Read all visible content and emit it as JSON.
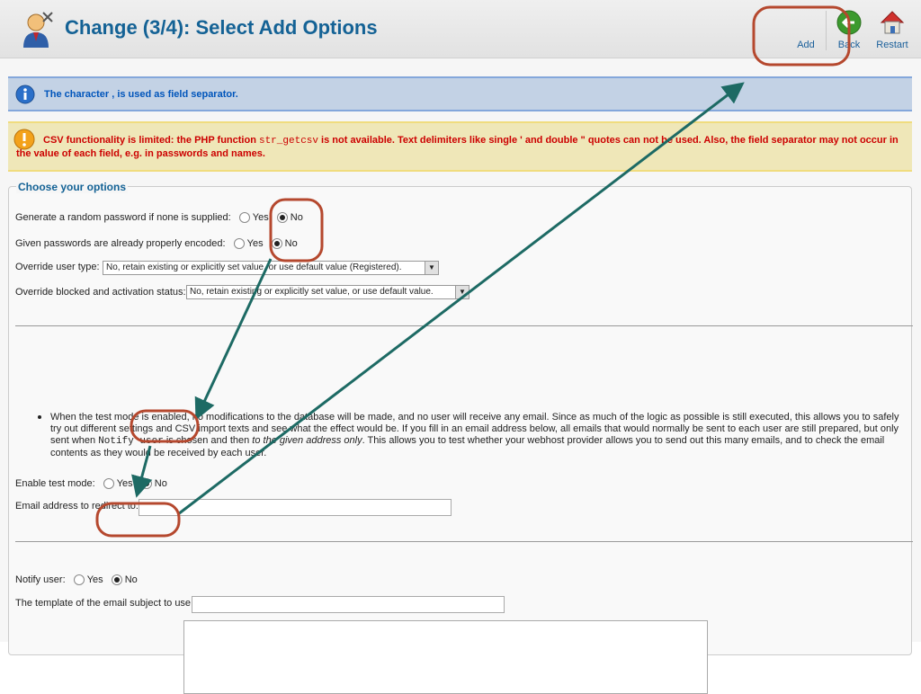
{
  "header": {
    "title": "Change (3/4): Select Add Options",
    "toolbar": {
      "add_label": "Add",
      "back_label": "Back",
      "restart_label": "Restart"
    }
  },
  "messages": {
    "info": "The character , is used as field separator.",
    "warning_pre": "CSV functionality is limited: the PHP function ",
    "warning_code": "str_getcsv",
    "warning_post": " is not available. Text delimiters like single ' and double \" quotes can not be used. Also, the field separator may not occur in the value of each field, e.g. in passwords and names."
  },
  "options": {
    "legend": "Choose your options",
    "random_password_label": "Generate a random password if none is supplied:",
    "encoded_label": "Given passwords are already properly encoded:",
    "yes_label": "Yes",
    "no_label": "No",
    "override_type_label": "Override user type:",
    "override_type_value": "No, retain existing or explicitly set value, or use default value (Registered).",
    "override_blocked_label": "Override blocked and activation status:",
    "override_blocked_value": "No, retain existing or explicitly set value, or use default value.",
    "test_mode_text_1": "When the test mode is enabled, no modifications to the database will be made, and no user will receive any email. Since as much of the logic as possible is still executed, this allows you to safely try out different settings and CSV import texts and see what the effect would be. If you fill in an email address below, all emails that would normally be sent to each user are still prepared, but only sent when ",
    "test_mode_code": "Notify user",
    "test_mode_text_2": " is chosen and then ",
    "test_mode_italic": "to the given address only",
    "test_mode_text_3": ". This allows you to test whether your webhost provider allows you to send out this many emails, and to check the email contents as they would be received by each user.",
    "enable_test_label": "Enable test mode:",
    "email_redirect_label": "Email address to redirect to:",
    "email_redirect_value": "",
    "notify_label": "Notify user:",
    "template_label": "The template of the email subject to use:",
    "template_value": ""
  },
  "colors": {
    "title": "#146295",
    "annotation_red": "#b5482e",
    "annotation_arrow": "#1d6a64"
  }
}
